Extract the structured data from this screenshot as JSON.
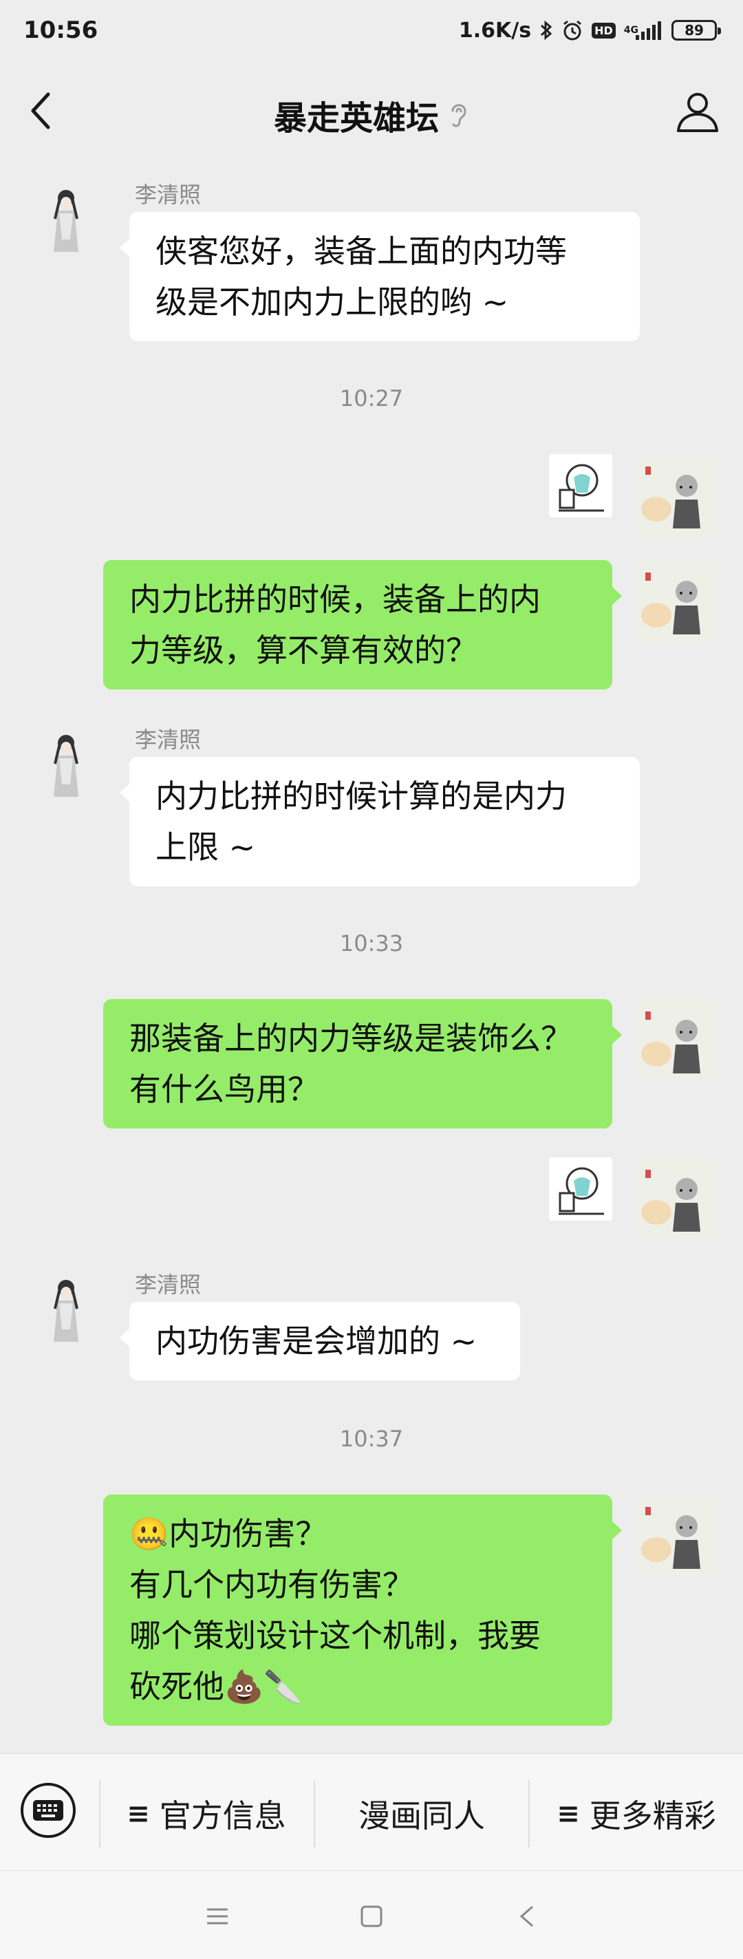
{
  "status_bar": {
    "time": "10:56",
    "net_speed": "1.6K/s",
    "hd": "HD",
    "network": "4G",
    "battery": "89"
  },
  "header": {
    "title": "暴走英雄坛",
    "back_icon": "chevron-left-icon",
    "voice_icon": "ear-icon",
    "profile_icon": "person-icon"
  },
  "messages": {
    "m1": {
      "sender": "李清照",
      "lines": [
        "侠客您好，装备上面的内功等",
        "级是不加内力上限的哟 ~"
      ]
    },
    "t1": "10:27",
    "m3": {
      "lines": [
        "内力比拼的时候，装备上的内",
        "力等级，算不算有效的？"
      ]
    },
    "m4": {
      "sender": "李清照",
      "lines": [
        "内力比拼的时候计算的是内力",
        "上限 ~"
      ]
    },
    "t2": "10:33",
    "m5": {
      "lines": [
        "那装备上的内力等级是装饰么？",
        "有什么鸟用？"
      ]
    },
    "m7": {
      "sender": "李清照",
      "lines": [
        "内功伤害是会增加的 ~"
      ]
    },
    "t3": "10:37",
    "m8": {
      "emoji_start": "🤐",
      "lines": [
        "内功伤害？",
        "有几个内功有伤害？",
        "哪个策划设计这个机制，我要",
        "砍死他"
      ],
      "emoji_end": "💩🔪"
    }
  },
  "menu": {
    "item1": "官方信息",
    "item2": "漫画同人",
    "item3": "更多精彩",
    "glyph": "≡"
  },
  "colors": {
    "background": "#ededed",
    "bubble_self": "#95ec69",
    "bubble_other": "#ffffff",
    "timestamp": "#8a8a8a"
  }
}
